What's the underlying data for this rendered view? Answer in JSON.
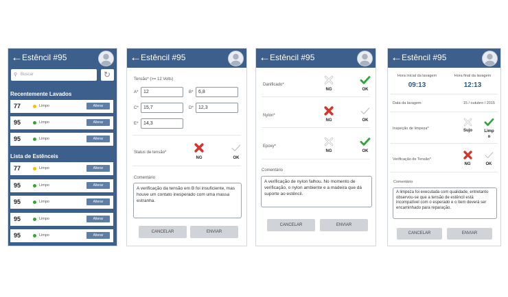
{
  "screen1": {
    "title": "Estêncil #95",
    "search_placeholder": "Buscar",
    "recent_title": "Recentemente Lavados",
    "recent": [
      {
        "num": "77",
        "status": "Limpo",
        "action": "Alterar",
        "dot": "#f2c200"
      },
      {
        "num": "95",
        "status": "Limpo",
        "action": "Alterar",
        "dot": "#33a532"
      },
      {
        "num": "95",
        "status": "Limpo",
        "action": "Alterar",
        "dot": "#33a532"
      }
    ],
    "list_title": "Lista de Estênceis",
    "list": [
      {
        "num": "77",
        "status": "Limpo",
        "action": "Alterar",
        "dot": "#f2c200"
      },
      {
        "num": "95",
        "status": "Limpo",
        "action": "Alterar",
        "dot": "#33a532"
      },
      {
        "num": "95",
        "status": "Limpo",
        "action": "Alterar",
        "dot": "#33a532"
      },
      {
        "num": "95",
        "status": "Limpo",
        "action": "Alterar",
        "dot": "#33a532"
      },
      {
        "num": "95",
        "status": "Limpo",
        "action": "Alterar",
        "dot": "#33a532"
      }
    ]
  },
  "screen2": {
    "title": "Estêncil #95",
    "tension_label": "Tensão* (>= 12 Volts)",
    "fields": {
      "a_label": "A*",
      "a_value": "12",
      "b_label": "B*",
      "b_value": "6,8",
      "c_label": "C*",
      "c_value": "15,7",
      "d_label": "D*",
      "d_value": "12,3",
      "e_label": "E*",
      "e_value": "14,3"
    },
    "status_label": "Status de tensão*",
    "ng": "NG",
    "ok": "OK",
    "comment_label": "Comentário",
    "comment": "A verificação da tensão em B foi insuficiente, mas houve um contato inesperado com uma massa estranha.",
    "cancel": "CANCELAR",
    "send": "ENVIAR"
  },
  "screen3": {
    "title": "Estêncil #95",
    "items": [
      {
        "label": "Danificado*",
        "ng": "NG",
        "ok": "OK"
      },
      {
        "label": "Nylon*",
        "ng": "NG",
        "ok": "OK"
      },
      {
        "label": "Epoxy*",
        "ng": "NG",
        "ok": "OK"
      }
    ],
    "comment_label": "Comentário",
    "comment": "A verificação de nylon falhou. No momento de verificação, o nylon ambiente e a madeira que dá suporte ao estêncil.",
    "cancel": "CANCELAR",
    "send": "ENVIAR"
  },
  "screen4": {
    "title": "Estêncil #95",
    "start_label": "Hora inicial da lavagem",
    "start_time": "09:13",
    "end_label": "Hora final da lavagem",
    "end_time": "12:13",
    "date_label": "Data da lavagem",
    "date_value": "15 / outubro / 2015",
    "clean_label": "Inspeção de limpeza*",
    "dirty": "Sujo",
    "clean": "Limpo",
    "tension_label": "Verificação de Tensão*",
    "ng": "NG",
    "ok": "OK",
    "comment_label": "Comentário",
    "comment": "A limpeza foi executada com qualidade, entretanto observou-se que a tensão de estêncil está incompatível com o esperado e o item deverá ser encaminhado para reparação.",
    "cancel": "CANCELAR",
    "send": "ENVIAR"
  },
  "colors": {
    "appbar": "#3d5f8c",
    "ok_green": "#2fa53a",
    "ng_red": "#d9342b"
  }
}
